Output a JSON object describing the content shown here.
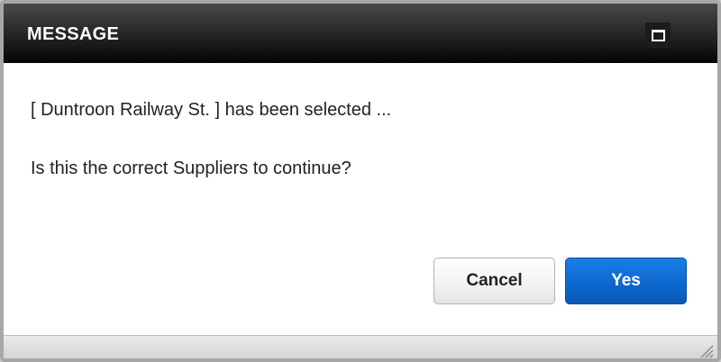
{
  "dialog": {
    "title": "MESSAGE",
    "message_line1": "[ Duntroon Railway St. ] has been selected ...",
    "message_line2": "Is this the correct Suppliers to continue?",
    "buttons": {
      "cancel_label": "Cancel",
      "yes_label": "Yes"
    },
    "icons": {
      "maximize": "maximize-icon",
      "resize": "resize-grip-icon"
    },
    "colors": {
      "titlebar": "#1a1a1a",
      "primary_button": "#0e68cf",
      "background": "#ffffff"
    }
  }
}
